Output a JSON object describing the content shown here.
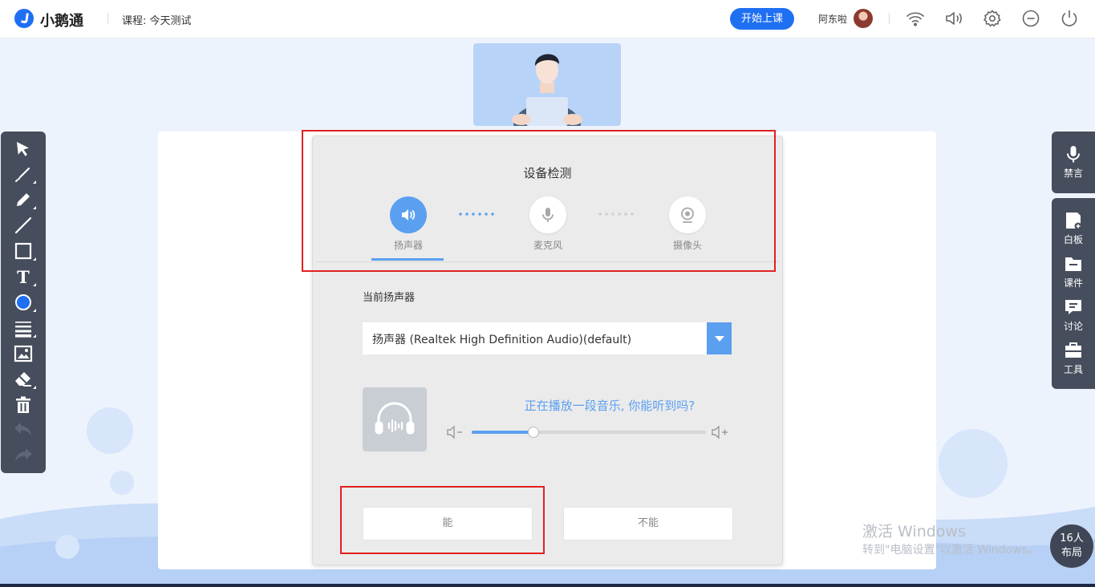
{
  "app": {
    "name": "小鹅通",
    "course_label": "课程: 今天测试",
    "start_class": "开始上课",
    "username": "阿东啦"
  },
  "top_icons": [
    "wifi-icon",
    "speaker-icon",
    "gear-icon",
    "minimize-icon",
    "power-icon"
  ],
  "left_toolbar": [
    "select-arrow",
    "laser-pointer",
    "pen",
    "line",
    "rectangle",
    "text",
    "color",
    "line-width",
    "image",
    "eraser",
    "delete",
    "undo",
    "redo"
  ],
  "right_toolbar": {
    "mute": "禁言",
    "items": [
      {
        "label": "白板"
      },
      {
        "label": "课件"
      },
      {
        "label": "讨论"
      },
      {
        "label": "工具"
      }
    ]
  },
  "people": {
    "count": "16人",
    "layout": "布局"
  },
  "dialog": {
    "title": "设备检测",
    "steps": [
      {
        "label": "扬声器",
        "icon": "speaker-icon",
        "active": true
      },
      {
        "label": "麦克风",
        "icon": "microphone-icon",
        "active": false
      },
      {
        "label": "摄像头",
        "icon": "camera-icon",
        "active": false
      }
    ],
    "current_label": "当前扬声器",
    "device_select": "扬声器 (Realtek High Definition Audio)(default)",
    "prompt": "正在播放一段音乐, 你能听到吗?",
    "volume": 0.26,
    "yes": "能",
    "no": "不能"
  },
  "watermark": {
    "line1": "激活 Windows",
    "line2": "转到\"电脑设置\"以激活 Windows。"
  },
  "colors": {
    "accent": "#1f6ff2",
    "dialog_accent": "#5b9ff0",
    "annotation": "#e02020"
  }
}
